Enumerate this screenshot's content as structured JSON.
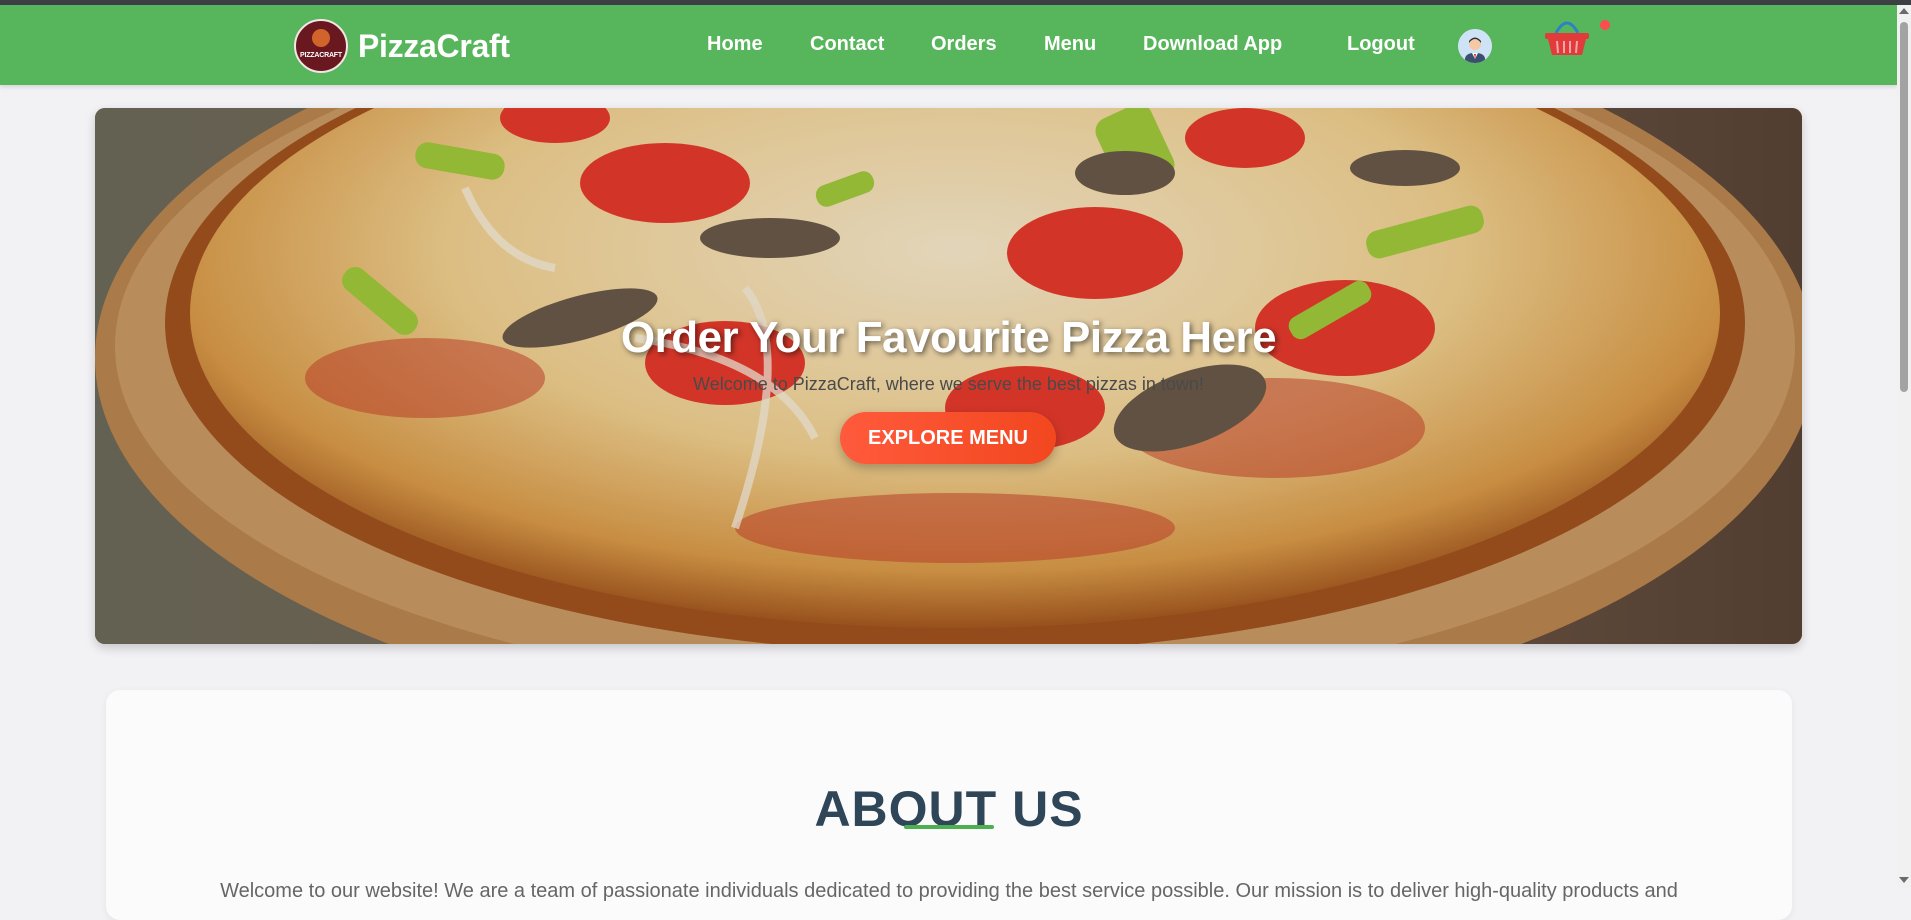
{
  "nav": {
    "brand": "PizzaCraft",
    "logo_text": "PIZZACRAFT",
    "links": [
      "Home",
      "Contact",
      "Orders",
      "Menu",
      "Download App"
    ],
    "logout": "Logout",
    "cart_has_items": true
  },
  "hero": {
    "title": "Order Your Favourite Pizza Here",
    "subtitle": "Welcome to PizzaCraft, where we serve the best pizzas in town!",
    "cta": "EXPLORE MENU"
  },
  "about": {
    "title": "ABOUT US",
    "text": "Welcome to our website! We are a team of passionate individuals dedicated to providing the best service possible. Our mission is to deliver high-quality products and"
  },
  "colors": {
    "navbar": "#57b55c",
    "cta": "#f2471f",
    "accent_line": "#4caf50",
    "heading": "#2f4558"
  },
  "icons": {
    "logo": "pizzacraft-logo-icon",
    "avatar": "user-avatar-icon",
    "cart": "shopping-basket-icon",
    "cart_badge": "notification-dot-icon"
  }
}
